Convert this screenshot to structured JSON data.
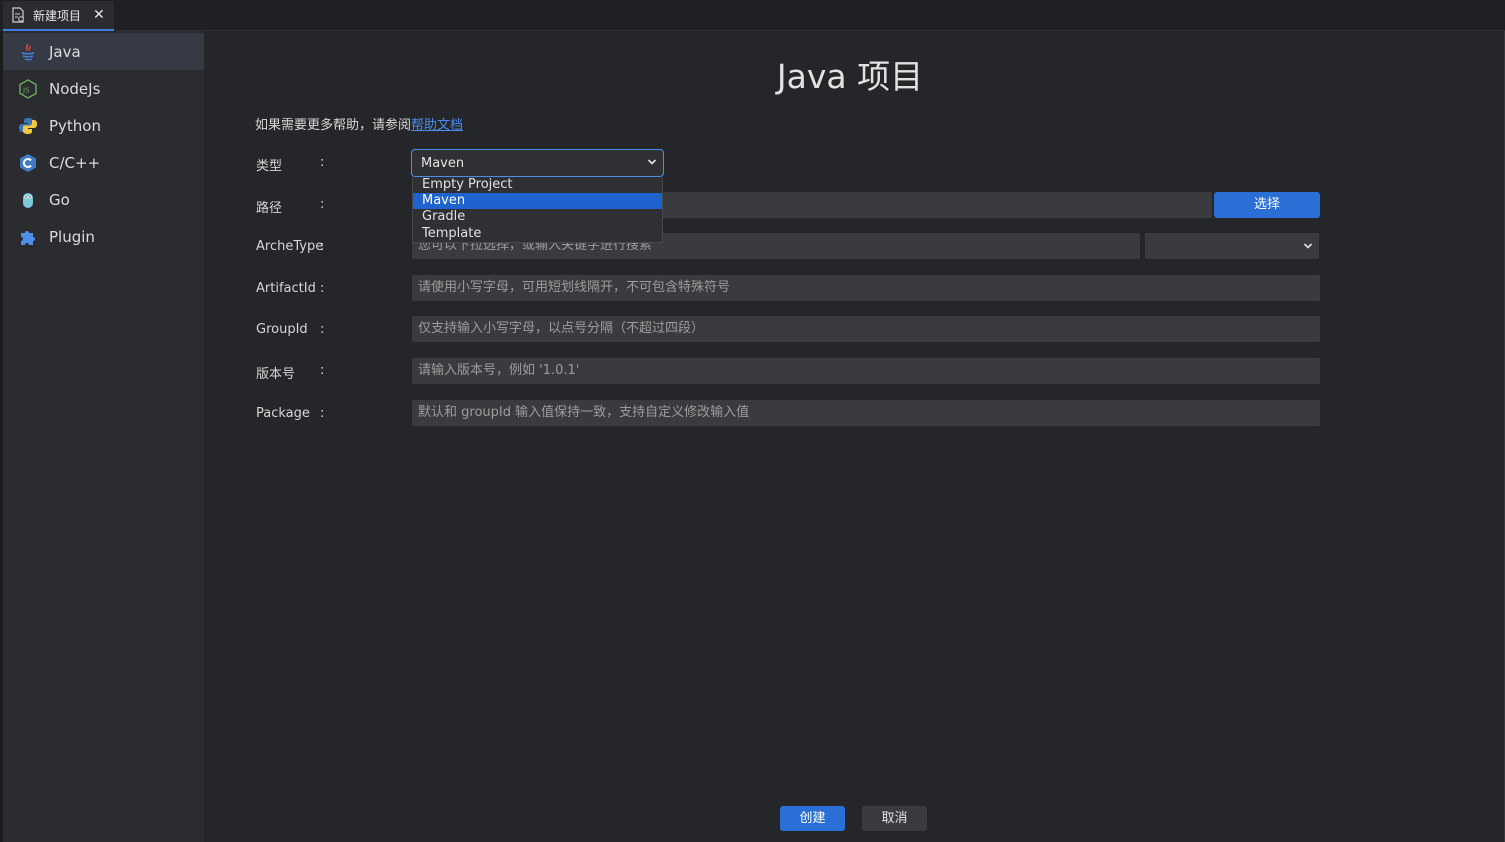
{
  "tab": {
    "label": "新建项目",
    "close": "✕"
  },
  "sidebar": {
    "items": [
      {
        "label": "Java",
        "icon": "java-icon",
        "active": true
      },
      {
        "label": "NodeJs",
        "icon": "nodejs-icon"
      },
      {
        "label": "Python",
        "icon": "python-icon"
      },
      {
        "label": "C/C++",
        "icon": "cpp-icon"
      },
      {
        "label": "Go",
        "icon": "go-icon"
      },
      {
        "label": "Plugin",
        "icon": "plugin-icon"
      }
    ]
  },
  "main": {
    "title": "Java 项目",
    "help_text": "如果需要更多帮助，请参阅",
    "help_link": "帮助文档",
    "colon": ":",
    "fields": {
      "type": {
        "label": "类型",
        "value": "Maven",
        "options": [
          "Empty Project",
          "Maven",
          "Gradle",
          "Template"
        ]
      },
      "path": {
        "label": "路径",
        "button": "选择"
      },
      "archetype": {
        "label": "ArcheType",
        "placeholder": "您可以下拉选择，或输入关键字进行搜索"
      },
      "artifactid": {
        "label": "ArtifactId",
        "placeholder": "请使用小写字母，可用短划线隔开，不可包含特殊符号"
      },
      "groupid": {
        "label": "GroupId",
        "placeholder": "仅支持输入小写字母，以点号分隔（不超过四段）"
      },
      "version": {
        "label": "版本号",
        "placeholder": "请输入版本号，例如 '1.0.1'"
      },
      "package": {
        "label": "Package",
        "placeholder": "默认和 groupId 输入值保持一致，支持自定义修改输入值"
      }
    },
    "buttons": {
      "create": "创建",
      "cancel": "取消"
    }
  },
  "colors": {
    "accent": "#2a6fd6",
    "link": "#4a8ff0",
    "background": "#252629",
    "sidebar": "#2b2c30"
  }
}
